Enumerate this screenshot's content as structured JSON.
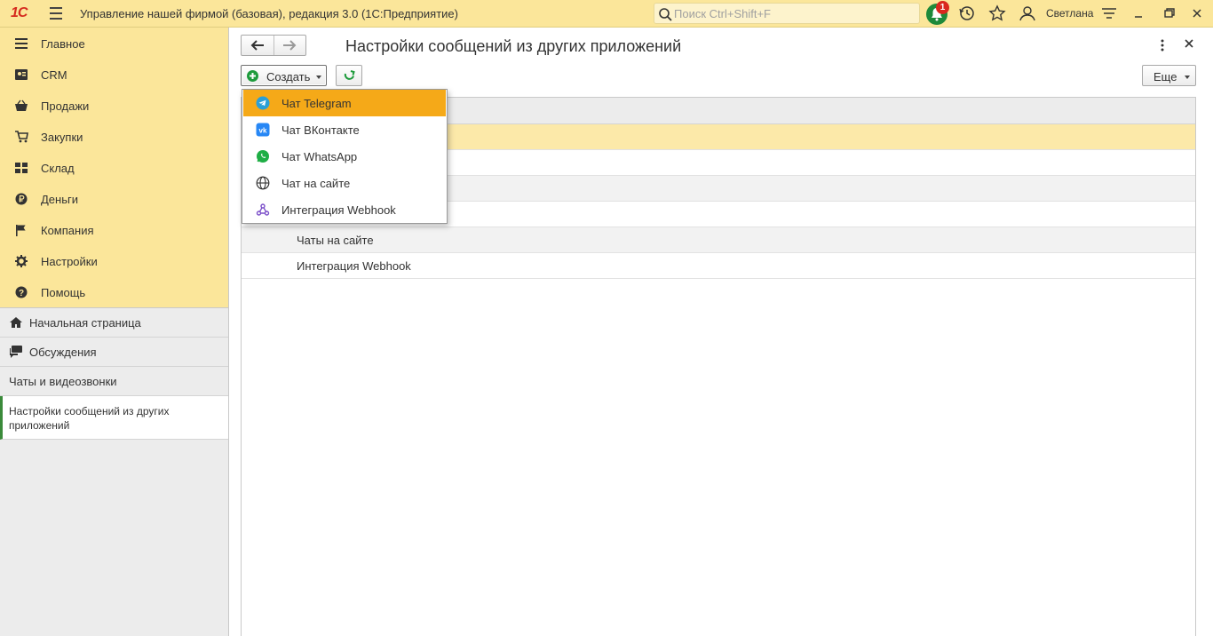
{
  "topbar": {
    "logo": "1С",
    "app_title": "Управление нашей фирмой (базовая), редакция 3.0  (1С:Предприятие)",
    "search_placeholder": "Поиск Ctrl+Shift+F",
    "notification_count": "1",
    "user_name": "Светлана"
  },
  "sidebar": {
    "sections": [
      {
        "label": "Главное",
        "icon": "list-icon"
      },
      {
        "label": "CRM",
        "icon": "contacts-icon"
      },
      {
        "label": "Продажи",
        "icon": "basket-icon"
      },
      {
        "label": "Закупки",
        "icon": "cart-icon"
      },
      {
        "label": "Склад",
        "icon": "warehouse-icon"
      },
      {
        "label": "Деньги",
        "icon": "ruble-icon"
      },
      {
        "label": "Компания",
        "icon": "flag-icon"
      },
      {
        "label": "Настройки",
        "icon": "gear-icon"
      },
      {
        "label": "Помощь",
        "icon": "help-icon"
      }
    ],
    "nav": [
      {
        "label": "Начальная страница",
        "icon": "home-icon"
      },
      {
        "label": "Обсуждения",
        "icon": "chat-icon"
      },
      {
        "label": "Чаты и видеозвонки"
      }
    ],
    "active": "Настройки сообщений из других приложений"
  },
  "main": {
    "title": "Настройки сообщений из других приложений",
    "create_label": "Создать",
    "more_label": "Еще",
    "rows": [
      {
        "label": ""
      },
      {
        "label": ""
      },
      {
        "label": ""
      },
      {
        "label": ""
      },
      {
        "label": "Чаты на сайте"
      },
      {
        "label": "Интеграция Webhook"
      }
    ]
  },
  "dropdown": {
    "items": [
      {
        "label": "Чат Telegram",
        "icon": "telegram-icon"
      },
      {
        "label": "Чат ВКонтакте",
        "icon": "vk-icon"
      },
      {
        "label": "Чат WhatsApp",
        "icon": "whatsapp-icon"
      },
      {
        "label": "Чат на сайте",
        "icon": "globe-icon"
      },
      {
        "label": "Интеграция Webhook",
        "icon": "webhook-icon"
      }
    ]
  },
  "colors": {
    "accent_yellow": "#fbe69a",
    "highlight_orange": "#f5a918",
    "selected_row": "#fce9a9",
    "green": "#1e9b3c"
  }
}
